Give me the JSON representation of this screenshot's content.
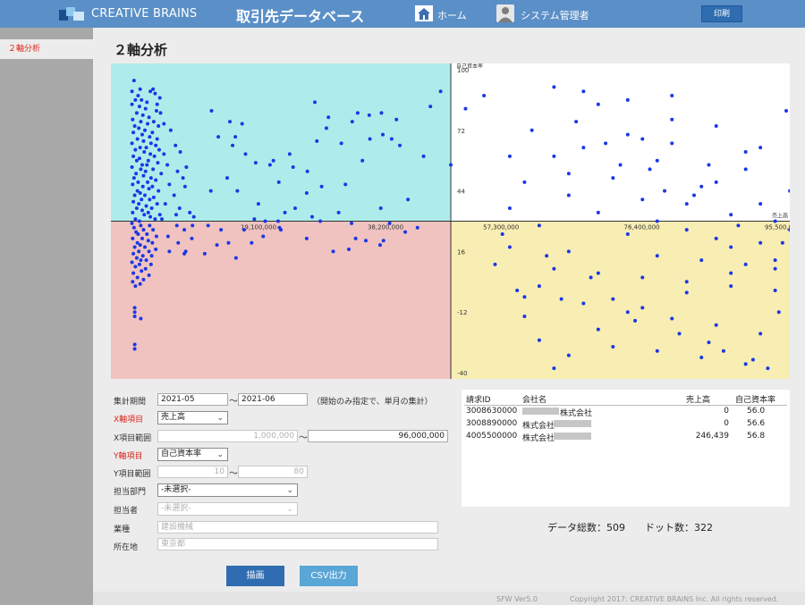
{
  "header": {
    "brand": "CREATIVE BRAINS",
    "app_title": "取引先データベース",
    "home_label": "ホーム",
    "user_label": "システム管理者",
    "print_label": "印刷",
    "bar_color": "#5b8fc7"
  },
  "sidebar": {
    "items": [
      {
        "label": "２軸分析",
        "active": true
      }
    ]
  },
  "page_title": "２軸分析",
  "form": {
    "period_label": "集計期間",
    "period_from": "2021-05",
    "period_to": "2021-06",
    "period_note": "（開始のみ指定で、単月の集計）",
    "x_axis_label": "X軸項目",
    "x_axis_value": "売上高",
    "x_range_label": "X項目範囲",
    "x_range_from": "1,000,000",
    "x_range_to": "96,000,000",
    "y_axis_label": "Y軸項目",
    "y_axis_value": "自己資本率",
    "y_range_label": "Y項目範囲",
    "y_range_from": "10",
    "y_range_to": "80",
    "dept_label": "担当部門",
    "dept_value": "-未選択-",
    "person_label": "担当者",
    "person_value": "-未選択-",
    "industry_label": "業種",
    "industry_placeholder": "建設機械",
    "location_label": "所在地",
    "location_placeholder": "東京都",
    "tilde": "～"
  },
  "buttons": {
    "draw": "描画",
    "csv": "CSV出力"
  },
  "table": {
    "columns": [
      "請求ID",
      "会社名",
      "売上高",
      "自己資本率"
    ],
    "rows": [
      {
        "id": "3008630000",
        "company": "株式会社",
        "sales": "0",
        "ratio": "56.0"
      },
      {
        "id": "3008890000",
        "company": "株式会社",
        "sales": "0",
        "ratio": "56.6"
      },
      {
        "id": "4005500000",
        "company": "株式会社",
        "sales": "246,439",
        "ratio": "56.8"
      }
    ]
  },
  "totals": "データ総数：509　　ドット数：322",
  "footer": {
    "version": "SFW Ver5.0",
    "copyright": "Copyright 2017: CREATIVE BRAINS Inc. All rights reserved."
  },
  "chart_data": {
    "type": "scatter",
    "xlabel": "売上高",
    "ylabel": "自己資本率",
    "x_ticks": [
      "19,100,000",
      "38,200,000",
      "57,300,000",
      "76,400,000",
      "95,500,000"
    ],
    "y_ticks": [
      "100",
      "72",
      "44",
      "16",
      "-12",
      "-40"
    ],
    "xlim": [
      0,
      95500000
    ],
    "ylim": [
      -40,
      100
    ],
    "x_axis_at_y": 30,
    "y_axis_at_x": 50000000,
    "quadrant_colors": {
      "top_left": "#aeeceb",
      "top_right": "#ffffff",
      "bottom_left": "#f0c3c0",
      "bottom_right": "#f8edb2"
    },
    "point_color": "#1b37e6",
    "points": [
      [
        3400000,
        95
      ],
      [
        4300000,
        91
      ],
      [
        6200000,
        91
      ],
      [
        3100000,
        90
      ],
      [
        5800000,
        90
      ],
      [
        6500000,
        89
      ],
      [
        4000000,
        88
      ],
      [
        7200000,
        87
      ],
      [
        3600000,
        86
      ],
      [
        4500000,
        86
      ],
      [
        5300000,
        85
      ],
      [
        3100000,
        84
      ],
      [
        4200000,
        83
      ],
      [
        5100000,
        82
      ],
      [
        6700000,
        81
      ],
      [
        7300000,
        80
      ],
      [
        3800000,
        80
      ],
      [
        4700000,
        79
      ],
      [
        5600000,
        78
      ],
      [
        3200000,
        77
      ],
      [
        6300000,
        76
      ],
      [
        4400000,
        76
      ],
      [
        5400000,
        75
      ],
      [
        3500000,
        74
      ],
      [
        7000000,
        74
      ],
      [
        4100000,
        73
      ],
      [
        5000000,
        72
      ],
      [
        6100000,
        71
      ],
      [
        3300000,
        71
      ],
      [
        4600000,
        70
      ],
      [
        5700000,
        69
      ],
      [
        6800000,
        68
      ],
      [
        3900000,
        68
      ],
      [
        4800000,
        67
      ],
      [
        3100000,
        66
      ],
      [
        5900000,
        66
      ],
      [
        6600000,
        65
      ],
      [
        4300000,
        64
      ],
      [
        5200000,
        64
      ],
      [
        3600000,
        63
      ],
      [
        7100000,
        63
      ],
      [
        4900000,
        62
      ],
      [
        5800000,
        61
      ],
      [
        3300000,
        60
      ],
      [
        6400000,
        60
      ],
      [
        4200000,
        59
      ],
      [
        5500000,
        58
      ],
      [
        3800000,
        58
      ],
      [
        6900000,
        57
      ],
      [
        4600000,
        56
      ],
      [
        5300000,
        56
      ],
      [
        3100000,
        55
      ],
      [
        6200000,
        54
      ],
      [
        4400000,
        54
      ],
      [
        5100000,
        53
      ],
      [
        3700000,
        52
      ],
      [
        7400000,
        52
      ],
      [
        4800000,
        51
      ],
      [
        5900000,
        50
      ],
      [
        3400000,
        50
      ],
      [
        6600000,
        49
      ],
      [
        4000000,
        48
      ],
      [
        5400000,
        48
      ],
      [
        3200000,
        47
      ],
      [
        6100000,
        46
      ],
      [
        4700000,
        46
      ],
      [
        5600000,
        45
      ],
      [
        3900000,
        44
      ],
      [
        7000000,
        44
      ],
      [
        4300000,
        43
      ],
      [
        5000000,
        42
      ],
      [
        3500000,
        42
      ],
      [
        6300000,
        41
      ],
      [
        4500000,
        40
      ],
      [
        5700000,
        40
      ],
      [
        3300000,
        39
      ],
      [
        6800000,
        38
      ],
      [
        4100000,
        38
      ],
      [
        5200000,
        37
      ],
      [
        3800000,
        36
      ],
      [
        6000000,
        36
      ],
      [
        4600000,
        35
      ],
      [
        5500000,
        34
      ],
      [
        3200000,
        34
      ],
      [
        7200000,
        33
      ],
      [
        4900000,
        33
      ],
      [
        5800000,
        32
      ],
      [
        3600000,
        31
      ],
      [
        6500000,
        31
      ],
      [
        4200000,
        30
      ],
      [
        3100000,
        29
      ],
      [
        4400000,
        28
      ],
      [
        5700000,
        28
      ],
      [
        3400000,
        27
      ],
      [
        6200000,
        26
      ],
      [
        4800000,
        26
      ],
      [
        3700000,
        25
      ],
      [
        5300000,
        24
      ],
      [
        4000000,
        24
      ],
      [
        6700000,
        23
      ],
      [
        3200000,
        22
      ],
      [
        4600000,
        22
      ],
      [
        5500000,
        21
      ],
      [
        3900000,
        20
      ],
      [
        6100000,
        20
      ],
      [
        4300000,
        19
      ],
      [
        5000000,
        18
      ],
      [
        3500000,
        18
      ],
      [
        6600000,
        17
      ],
      [
        4100000,
        16
      ],
      [
        5600000,
        16
      ],
      [
        3300000,
        15
      ],
      [
        4700000,
        14
      ],
      [
        6000000,
        14
      ],
      [
        3800000,
        13
      ],
      [
        5200000,
        12
      ],
      [
        4400000,
        12
      ],
      [
        3100000,
        11
      ],
      [
        5900000,
        10
      ],
      [
        4200000,
        10
      ],
      [
        3600000,
        9
      ],
      [
        5100000,
        8
      ],
      [
        4500000,
        7
      ],
      [
        3300000,
        6
      ],
      [
        5600000,
        5
      ],
      [
        3900000,
        4
      ],
      [
        4800000,
        3
      ],
      [
        3200000,
        2
      ],
      [
        4300000,
        1
      ],
      [
        3600000,
        0
      ],
      [
        3500000,
        -10
      ],
      [
        3500000,
        -12
      ],
      [
        3500000,
        -14
      ],
      [
        4400000,
        -15
      ],
      [
        3500000,
        -27
      ],
      [
        3500000,
        -29
      ],
      [
        6800000,
        84
      ],
      [
        7800000,
        75
      ],
      [
        8800000,
        72
      ],
      [
        9500000,
        65
      ],
      [
        10200000,
        62
      ],
      [
        7800000,
        61
      ],
      [
        8300000,
        56
      ],
      [
        11100000,
        55
      ],
      [
        9800000,
        53
      ],
      [
        10600000,
        50
      ],
      [
        8600000,
        47
      ],
      [
        10900000,
        46
      ],
      [
        9300000,
        42
      ],
      [
        8000000,
        38
      ],
      [
        10100000,
        36
      ],
      [
        11600000,
        34
      ],
      [
        9600000,
        33
      ],
      [
        12200000,
        32
      ],
      [
        7500000,
        31
      ],
      [
        12000000,
        28
      ],
      [
        9700000,
        28
      ],
      [
        10800000,
        26
      ],
      [
        8400000,
        23
      ],
      [
        11900000,
        22
      ],
      [
        9900000,
        20
      ],
      [
        11000000,
        16
      ],
      [
        8600000,
        16
      ],
      [
        10800000,
        15
      ],
      [
        14800000,
        81
      ],
      [
        17500000,
        76
      ],
      [
        19300000,
        75
      ],
      [
        15800000,
        69
      ],
      [
        18300000,
        69
      ],
      [
        17900000,
        65
      ],
      [
        19800000,
        61
      ],
      [
        21300000,
        57
      ],
      [
        17100000,
        50
      ],
      [
        14700000,
        44
      ],
      [
        18600000,
        44
      ],
      [
        21700000,
        38
      ],
      [
        14300000,
        28
      ],
      [
        16200000,
        26
      ],
      [
        19600000,
        26
      ],
      [
        25000000,
        26
      ],
      [
        22400000,
        23
      ],
      [
        17300000,
        20
      ],
      [
        20700000,
        20
      ],
      [
        15600000,
        19
      ],
      [
        13800000,
        15
      ],
      [
        18400000,
        13
      ],
      [
        23900000,
        58
      ],
      [
        26800000,
        55
      ],
      [
        28900000,
        53
      ],
      [
        31700000,
        73
      ],
      [
        35500000,
        76
      ],
      [
        38100000,
        68
      ],
      [
        41300000,
        68
      ],
      [
        30300000,
        67
      ],
      [
        26300000,
        61
      ],
      [
        23400000,
        56
      ],
      [
        24700000,
        48
      ],
      [
        28800000,
        43
      ],
      [
        31000000,
        46
      ],
      [
        34500000,
        47
      ],
      [
        33500000,
        34
      ],
      [
        39700000,
        36
      ],
      [
        43700000,
        40
      ],
      [
        27100000,
        36
      ],
      [
        25600000,
        34
      ],
      [
        29600000,
        32
      ],
      [
        30800000,
        30
      ],
      [
        22700000,
        30
      ],
      [
        24600000,
        30
      ],
      [
        35400000,
        29
      ],
      [
        21100000,
        31
      ],
      [
        24800000,
        27
      ],
      [
        28800000,
        22
      ],
      [
        32700000,
        16
      ],
      [
        36000000,
        22
      ],
      [
        35000000,
        17
      ],
      [
        37500000,
        21
      ],
      [
        39600000,
        19
      ],
      [
        40100000,
        21
      ],
      [
        41000000,
        29
      ],
      [
        43300000,
        25
      ],
      [
        45100000,
        27
      ],
      [
        30000000,
        85
      ],
      [
        32000000,
        78
      ],
      [
        33900000,
        66
      ],
      [
        36300000,
        80
      ],
      [
        38000000,
        79
      ],
      [
        39800000,
        80
      ],
      [
        42000000,
        77
      ],
      [
        47000000,
        83
      ],
      [
        48500000,
        90
      ],
      [
        52000000,
        82
      ],
      [
        54500000,
        88
      ],
      [
        40000000,
        70
      ],
      [
        42500000,
        65
      ],
      [
        46000000,
        60
      ],
      [
        50000000,
        56
      ],
      [
        37000000,
        58
      ],
      [
        95500000,
        81
      ],
      [
        80000000,
        77
      ],
      [
        76000000,
        68
      ],
      [
        68000000,
        64
      ],
      [
        64000000,
        60
      ],
      [
        78000000,
        58
      ],
      [
        85000000,
        56
      ],
      [
        90000000,
        54
      ],
      [
        72000000,
        50
      ],
      [
        60000000,
        48
      ],
      [
        66000000,
        42
      ],
      [
        82000000,
        38
      ],
      [
        70000000,
        34
      ],
      [
        88000000,
        33
      ],
      [
        94000000,
        30
      ],
      [
        62000000,
        28
      ],
      [
        74000000,
        24
      ],
      [
        86000000,
        22
      ],
      [
        92000000,
        20
      ],
      [
        58000000,
        18
      ],
      [
        66000000,
        16
      ],
      [
        78000000,
        14
      ],
      [
        84000000,
        12
      ],
      [
        90000000,
        10
      ],
      [
        64000000,
        8
      ],
      [
        70000000,
        6
      ],
      [
        76000000,
        4
      ],
      [
        82000000,
        2
      ],
      [
        88000000,
        0
      ],
      [
        94000000,
        -2
      ],
      [
        60000000,
        -5
      ],
      [
        68000000,
        -8
      ],
      [
        74000000,
        -12
      ],
      [
        80000000,
        -15
      ],
      [
        86000000,
        -18
      ],
      [
        92000000,
        -22
      ],
      [
        62000000,
        -25
      ],
      [
        72000000,
        -28
      ],
      [
        78000000,
        -30
      ],
      [
        84000000,
        -33
      ],
      [
        90000000,
        -36
      ],
      [
        64000000,
        -38
      ],
      [
        70000000,
        -20
      ],
      [
        76000000,
        -10
      ],
      [
        82000000,
        -3
      ],
      [
        88000000,
        6
      ],
      [
        94000000,
        12
      ],
      [
        58000000,
        36
      ],
      [
        66000000,
        52
      ],
      [
        74000000,
        70
      ],
      [
        80000000,
        88
      ],
      [
        86000000,
        74
      ],
      [
        92000000,
        64
      ],
      [
        96000000,
        44
      ],
      [
        58000000,
        60
      ],
      [
        64000000,
        92
      ],
      [
        70000000,
        84
      ],
      [
        76000000,
        40
      ],
      [
        82000000,
        26
      ],
      [
        88000000,
        18
      ],
      [
        94000000,
        8
      ],
      [
        60000000,
        -14
      ],
      [
        66000000,
        -32
      ],
      [
        72000000,
        -6
      ],
      [
        78000000,
        30
      ],
      [
        84000000,
        46
      ],
      [
        90000000,
        62
      ],
      [
        94500000,
        -12
      ],
      [
        61000000,
        72
      ],
      [
        67000000,
        76
      ],
      [
        73000000,
        56
      ],
      [
        79000000,
        44
      ],
      [
        85000000,
        -26
      ],
      [
        91000000,
        -34
      ],
      [
        57000000,
        24
      ],
      [
        63000000,
        14
      ],
      [
        69000000,
        4
      ],
      [
        75000000,
        -16
      ],
      [
        81000000,
        -22
      ],
      [
        87000000,
        -30
      ],
      [
        93000000,
        -38
      ],
      [
        59000000,
        -2
      ],
      [
        65000000,
        -6
      ],
      [
        71000000,
        66
      ],
      [
        77000000,
        54
      ],
      [
        83000000,
        42
      ],
      [
        89000000,
        28
      ],
      [
        95000000,
        20
      ],
      [
        56000000,
        10
      ],
      [
        62000000,
        0
      ],
      [
        68000000,
        90
      ],
      [
        74000000,
        86
      ],
      [
        80000000,
        66
      ],
      [
        86000000,
        48
      ],
      [
        92000000,
        38
      ],
      [
        96000000,
        26
      ]
    ]
  }
}
